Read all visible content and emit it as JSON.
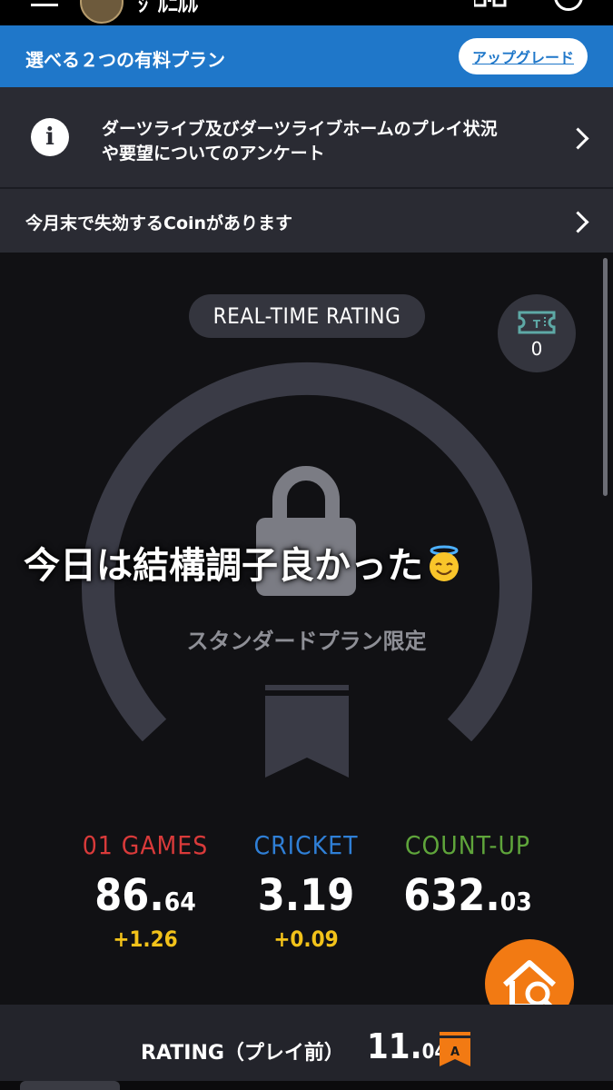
{
  "header": {
    "username": "ｼﾞﾙﾆﾙﾙ"
  },
  "banner": {
    "text": "選べる２つの有料プラン",
    "button_label": "アップグレード"
  },
  "notice_rows": [
    {
      "line1": "ダーツライブ及びダーツライブホームのプレイ状況",
      "line2": "や要望についてのアンケート"
    },
    {
      "line1": "今月末で失効するCoinがあります"
    }
  ],
  "main": {
    "realtime_label": "REAL-TIME RATING",
    "ticket_count": "0",
    "locked_text": "スタンダードプラン限定",
    "overlay_caption": "今日は結構調子良かった",
    "stats": [
      {
        "label": "01 GAMES",
        "value_int": "86.",
        "value_dec": "64",
        "delta": "+1.26",
        "color": "#d93a3a"
      },
      {
        "label": "CRICKET",
        "value_int": "3.19",
        "value_dec": "",
        "delta": "+0.09",
        "color": "#2f7fd6"
      },
      {
        "label": "COUNT-UP",
        "value_int": "632.",
        "value_dec": "03",
        "delta": "",
        "color": "#5fa53b"
      }
    ]
  },
  "rating_bar": {
    "label": "RATING（プレイ前）",
    "value_int": "11.",
    "value_dec": "04",
    "badge": "A",
    "badge_color": "#f27a13"
  },
  "icons": {
    "info": "info-icon",
    "chevron": "chevron-right-icon",
    "ticket": "ticket-icon",
    "lock": "lock-icon",
    "ribbon": "ribbon-icon",
    "home_search": "home-search-icon",
    "emoji": "smiling-face-with-halo-icon"
  },
  "colors": {
    "banner": "#1f77c9",
    "row_bg": "#2a2b33",
    "fab": "#f27a13",
    "delta": "#f2c21a"
  }
}
